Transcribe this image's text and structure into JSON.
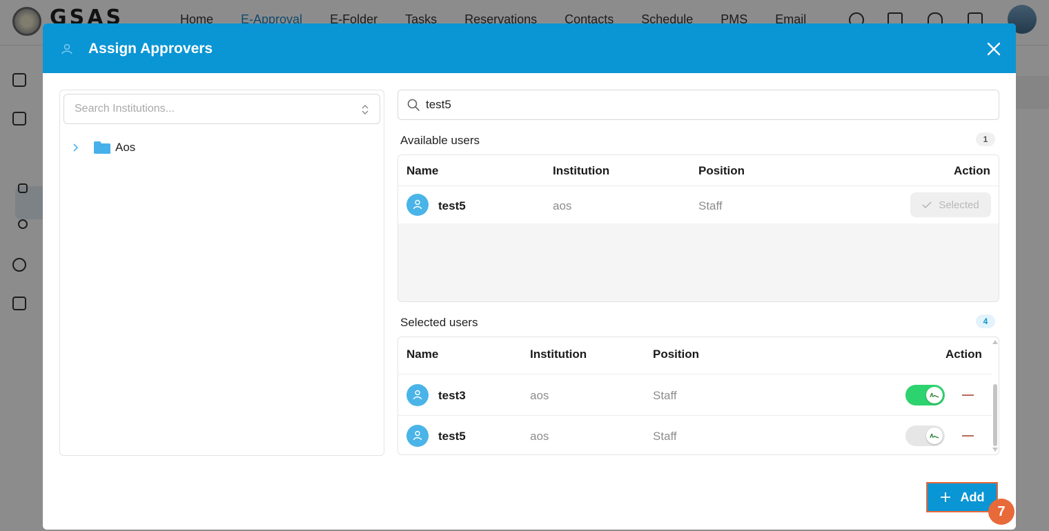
{
  "app": {
    "logo_text": "GSAS",
    "nav": [
      "Home",
      "E-Approval",
      "E-Folder",
      "Tasks",
      "Reservations",
      "Contacts",
      "Schedule",
      "PMS",
      "Email"
    ],
    "active_nav": "E-Approval"
  },
  "modal": {
    "title": "Assign Approvers",
    "institutions": {
      "placeholder": "Search Institutions...",
      "tree": [
        {
          "label": "Aos",
          "icon": "folder-icon",
          "expanded": false
        }
      ]
    },
    "search": {
      "value": "test5"
    },
    "available": {
      "title": "Available users",
      "count": "1",
      "columns": {
        "name": "Name",
        "institution": "Institution",
        "position": "Position",
        "action": "Action"
      },
      "rows": [
        {
          "name": "test5",
          "institution": "aos",
          "position": "Staff",
          "action_label": "Selected"
        }
      ]
    },
    "selected": {
      "title": "Selected users",
      "count": "4",
      "columns": {
        "name": "Name",
        "institution": "Institution",
        "position": "Position",
        "action": "Action"
      },
      "rows": [
        {
          "name": "test3",
          "institution": "aos",
          "position": "Staff",
          "signature_toggle": true
        },
        {
          "name": "test5",
          "institution": "aos",
          "position": "Staff",
          "signature_toggle": false
        }
      ]
    },
    "add_label": "Add",
    "step_number": "7"
  },
  "colors": {
    "header_blue": "#0a95d4",
    "toggle_on": "#2dd36f",
    "highlight_orange": "#e8693a"
  }
}
